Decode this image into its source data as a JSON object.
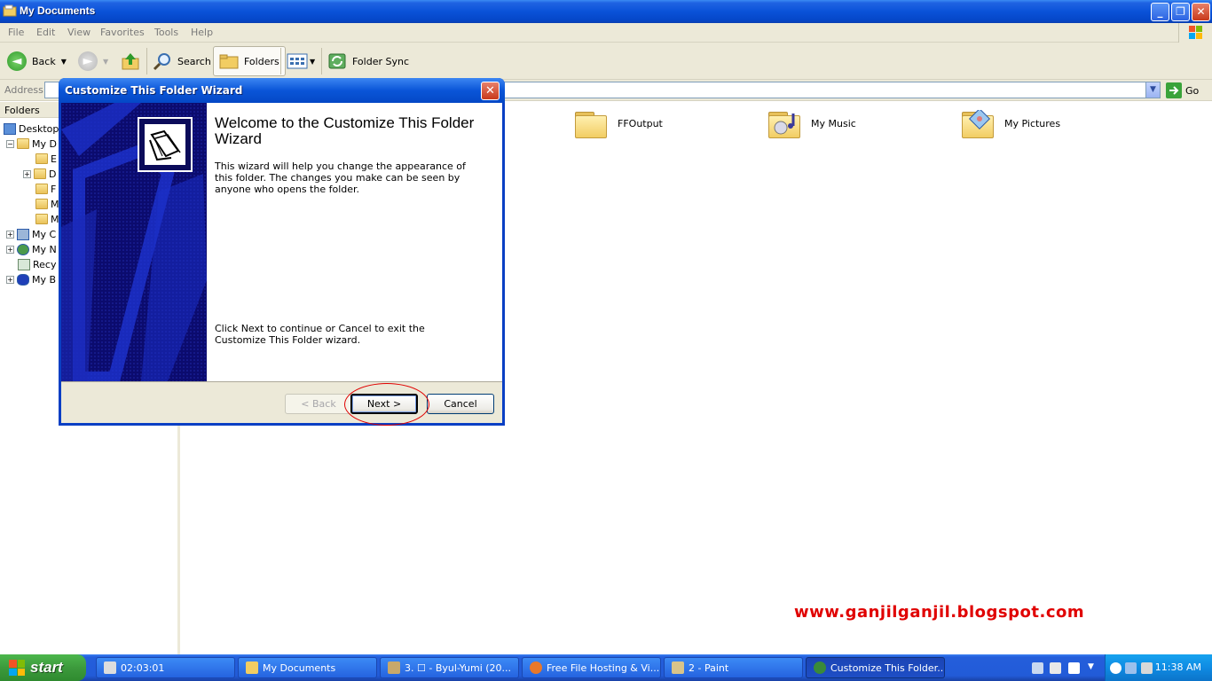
{
  "window": {
    "title": "My Documents",
    "buttons": {
      "minimize": "_",
      "restore": "❐",
      "close": "✕"
    }
  },
  "menu": [
    "File",
    "Edit",
    "View",
    "Favorites",
    "Tools",
    "Help"
  ],
  "toolbar": {
    "back": "Back",
    "search": "Search",
    "folders": "Folders",
    "folder_sync": "Folder Sync"
  },
  "address": {
    "label": "Address",
    "value": "",
    "go": "Go"
  },
  "tree": {
    "header": "Folders",
    "rows": [
      {
        "label": "Desktop",
        "expander": ""
      },
      {
        "label": "My D",
        "expander": "−"
      },
      {
        "label": "E",
        "expander": ""
      },
      {
        "label": "D",
        "expander": "+"
      },
      {
        "label": "F",
        "expander": ""
      },
      {
        "label": "M",
        "expander": ""
      },
      {
        "label": "M",
        "expander": ""
      },
      {
        "label": "My C",
        "expander": "+"
      },
      {
        "label": "My N",
        "expander": "+"
      },
      {
        "label": "Recy",
        "expander": ""
      },
      {
        "label": "My B",
        "expander": "+"
      }
    ]
  },
  "content": {
    "items": [
      {
        "label": "FFOutput",
        "icon": "folder-icon"
      },
      {
        "label": "My Music",
        "icon": "music-folder-icon"
      },
      {
        "label": "My Pictures",
        "icon": "pictures-folder-icon"
      }
    ]
  },
  "watermark": "www.ganjilganjil.blogspot.com",
  "dialog": {
    "title": "Customize This Folder Wizard",
    "close": "✕",
    "heading": "Welcome to the Customize This Folder Wizard",
    "intro": "This wizard will help you change the appearance of this folder. The changes you make can be seen by anyone who opens the folder.",
    "instruction": "Click Next to continue or Cancel to exit the Customize This Folder wizard.",
    "back_button": "< Back",
    "next_button": "Next >",
    "cancel_button": "Cancel"
  },
  "taskbar": {
    "start": "start",
    "tasks": [
      {
        "label": "02:03:01",
        "active": false
      },
      {
        "label": "My Documents",
        "active": false
      },
      {
        "label": "3. ☐ - Byul-Yumi (20...",
        "active": false
      },
      {
        "label": "Free File Hosting & Vi...",
        "active": false
      },
      {
        "label": "2 - Paint",
        "active": false
      },
      {
        "label": "Customize This Folder...",
        "active": true
      }
    ],
    "clock": "11:38 AM"
  },
  "colors": {
    "xp_blue": "#0a52d8",
    "start_green": "#3c9a3c",
    "watermark_red": "#e00000"
  }
}
